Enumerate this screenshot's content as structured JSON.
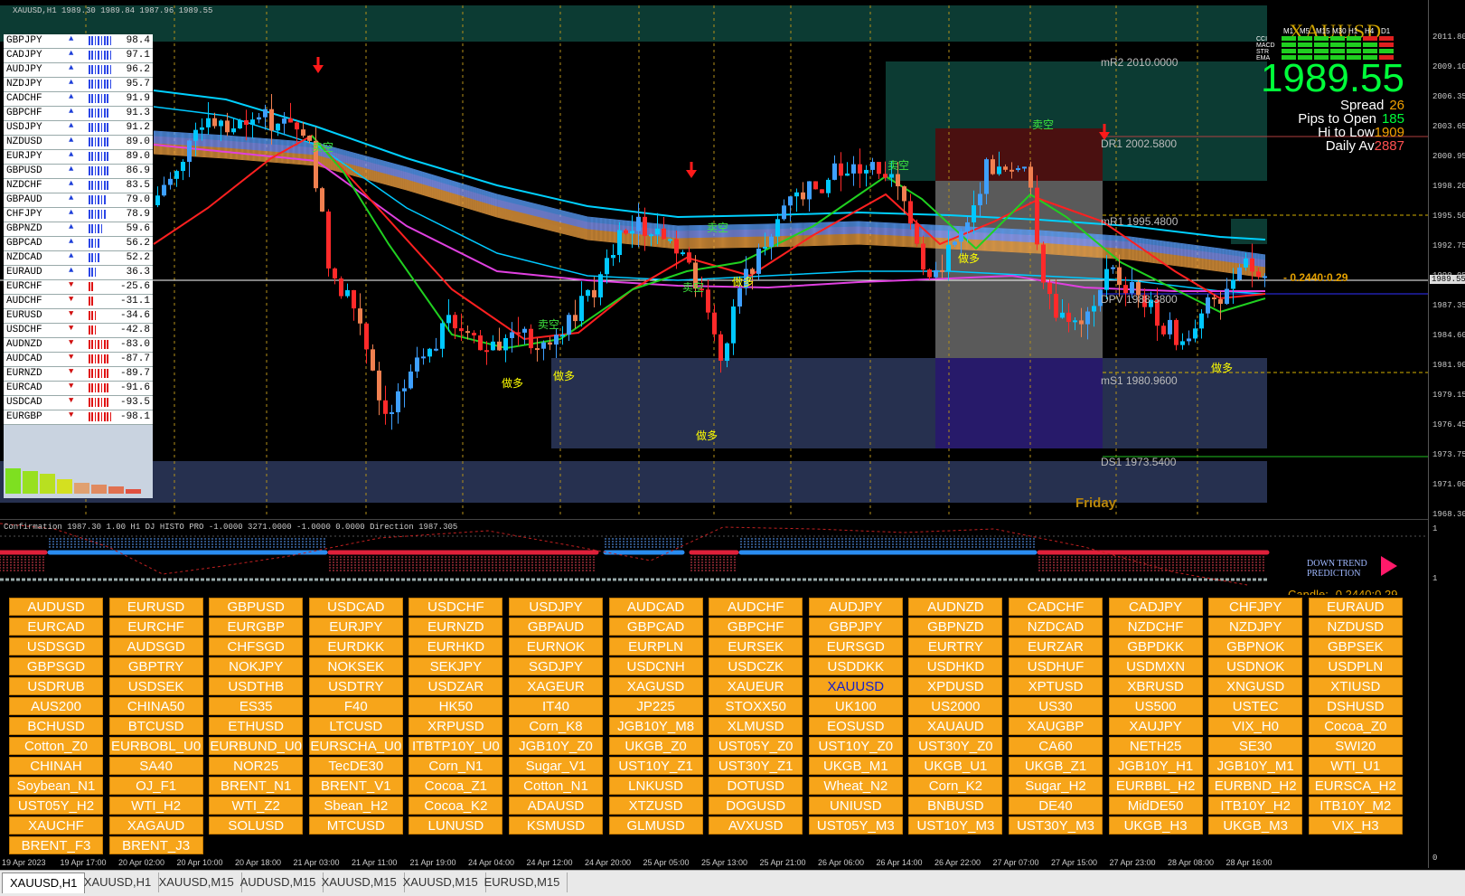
{
  "chart_header": "XAUUSD,H1  1989.30 1989.84 1987.96 1989.55",
  "symbol": "XAUUSD",
  "price_axis": [
    "2011.80",
    "2009.10",
    "2006.35",
    "2003.65",
    "2000.95",
    "1998.20",
    "1995.50",
    "1992.75",
    "1990.05",
    "1987.35",
    "1984.60",
    "1981.90",
    "1979.15",
    "1976.45",
    "1973.75",
    "1971.00",
    "1968.30"
  ],
  "current_price_tag": "1989.55",
  "osc_axis": [
    "1",
    "1",
    "0"
  ],
  "info_panel": {
    "title": "XAUUSD",
    "tf_labels": [
      "M1",
      "M5",
      "M15",
      "M30",
      "H1",
      "H4",
      "D1"
    ],
    "row_labels": [
      "CCI",
      "MACD",
      "STR",
      "EMA"
    ],
    "price": "1989.55",
    "spread_label": "Spread",
    "spread_value": "26",
    "pips_label": "Pips to Open",
    "pips_value": "185",
    "hilo_label": "Hi to Low",
    "hilo_value": "1909",
    "daily_label": "Daily Av",
    "daily_value": "2887"
  },
  "strength_table": [
    {
      "sym": "GBPJPY",
      "val": "98.4",
      "up": true
    },
    {
      "sym": "CADJPY",
      "val": "97.1",
      "up": true
    },
    {
      "sym": "AUDJPY",
      "val": "96.2",
      "up": true
    },
    {
      "sym": "NZDJPY",
      "val": "95.7",
      "up": true
    },
    {
      "sym": "CADCHF",
      "val": "91.9",
      "up": true
    },
    {
      "sym": "GBPCHF",
      "val": "91.3",
      "up": true
    },
    {
      "sym": "USDJPY",
      "val": "91.2",
      "up": true
    },
    {
      "sym": "NZDUSD",
      "val": "89.0",
      "up": true
    },
    {
      "sym": "EURJPY",
      "val": "89.0",
      "up": true
    },
    {
      "sym": "GBPUSD",
      "val": "86.9",
      "up": true
    },
    {
      "sym": "NZDCHF",
      "val": "83.5",
      "up": true
    },
    {
      "sym": "GBPAUD",
      "val": "79.0",
      "up": true
    },
    {
      "sym": "CHFJPY",
      "val": "78.9",
      "up": true
    },
    {
      "sym": "GBPNZD",
      "val": "59.6",
      "up": true
    },
    {
      "sym": "GBPCAD",
      "val": "56.2",
      "up": true
    },
    {
      "sym": "NZDCAD",
      "val": "52.2",
      "up": true
    },
    {
      "sym": "EURAUD",
      "val": "36.3",
      "up": true
    },
    {
      "sym": "EURCHF",
      "val": "-25.6",
      "up": false
    },
    {
      "sym": "AUDCHF",
      "val": "-31.1",
      "up": false
    },
    {
      "sym": "EURUSD",
      "val": "-34.6",
      "up": false
    },
    {
      "sym": "USDCHF",
      "val": "-42.8",
      "up": false
    },
    {
      "sym": "AUDNZD",
      "val": "-83.0",
      "up": false
    },
    {
      "sym": "AUDCAD",
      "val": "-87.7",
      "up": false
    },
    {
      "sym": "EURNZD",
      "val": "-89.7",
      "up": false
    },
    {
      "sym": "EURCAD",
      "val": "-91.6",
      "up": false
    },
    {
      "sym": "USDCAD",
      "val": "-93.5",
      "up": false
    },
    {
      "sym": "EURGBP",
      "val": "-98.1",
      "up": false
    }
  ],
  "currency_labels": [
    "GBP",
    "CAD",
    "NZD",
    "AUD",
    "EUR",
    "USD",
    "CHF",
    "JPY"
  ],
  "zones": {
    "mR2": "mR2  2010.0000",
    "DR1": "DR1  2002.5800",
    "mR1": "mR1  1995.4800",
    "DPV": "DPV  1988.3800",
    "mS1": "mS1  1980.9600",
    "DS1": "DS1  1973.5400"
  },
  "signals": {
    "buy": "做多",
    "sell": "卖空"
  },
  "friday_label": "Friday",
  "price_line_label": "0.2440:0.29",
  "osc_header": "Confirmation 1987.30 1.00  H1 DJ HISTO PRO -1.0000 3271.0000 -1.0000 0.0000  Direction 1987.305",
  "prediction": {
    "line1": "DOWN TREND",
    "line2": "PREDICTION"
  },
  "candle_label": "Candle: -0.2440:0.29",
  "buttons": [
    "AUDUSD",
    "EURUSD",
    "GBPUSD",
    "USDCAD",
    "USDCHF",
    "USDJPY",
    "AUDCAD",
    "AUDCHF",
    "AUDJPY",
    "AUDNZD",
    "CADCHF",
    "CADJPY",
    "CHFJPY",
    "EURAUD",
    "EURCAD",
    "EURCHF",
    "EURGBP",
    "EURJPY",
    "EURNZD",
    "GBPAUD",
    "GBPCAD",
    "GBPCHF",
    "GBPJPY",
    "GBPNZD",
    "NZDCAD",
    "NZDCHF",
    "NZDJPY",
    "NZDUSD",
    "USDSGD",
    "AUDSGD",
    "CHFSGD",
    "EURDKK",
    "EURHKD",
    "EURNOK",
    "EURPLN",
    "EURSEK",
    "EURSGD",
    "EURTRY",
    "EURZAR",
    "GBPDKK",
    "GBPNOK",
    "GBPSEK",
    "GBPSGD",
    "GBPTRY",
    "NOKJPY",
    "NOKSEK",
    "SEKJPY",
    "SGDJPY",
    "USDCNH",
    "USDCZK",
    "USDDKK",
    "USDHKD",
    "USDHUF",
    "USDMXN",
    "USDNOK",
    "USDPLN",
    "USDRUB",
    "USDSEK",
    "USDTHB",
    "USDTRY",
    "USDZAR",
    "XAGEUR",
    "XAGUSD",
    "XAUEUR",
    "XAUUSD",
    "XPDUSD",
    "XPTUSD",
    "XBRUSD",
    "XNGUSD",
    "XTIUSD",
    "AUS200",
    "CHINA50",
    "ES35",
    "F40",
    "HK50",
    "IT40",
    "JP225",
    "STOXX50",
    "UK100",
    "US2000",
    "US30",
    "US500",
    "USTEC",
    "DSHUSD",
    "BCHUSD",
    "BTCUSD",
    "ETHUSD",
    "LTCUSD",
    "XRPUSD",
    "Corn_K8",
    "JGB10Y_M8",
    "XLMUSD",
    "EOSUSD",
    "XAUAUD",
    "XAUGBP",
    "XAUJPY",
    "VIX_H0",
    "Cocoa_Z0",
    "Cotton_Z0",
    "EURBOBL_U0",
    "EURBUND_U0",
    "EURSCHA_U0",
    "ITBTP10Y_U0",
    "JGB10Y_Z0",
    "UKGB_Z0",
    "UST05Y_Z0",
    "UST10Y_Z0",
    "UST30Y_Z0",
    "CA60",
    "NETH25",
    "SE30",
    "SWI20",
    "CHINAH",
    "SA40",
    "NOR25",
    "TecDE30",
    "Corn_N1",
    "Sugar_V1",
    "UST10Y_Z1",
    "UST30Y_Z1",
    "UKGB_M1",
    "UKGB_U1",
    "UKGB_Z1",
    "JGB10Y_H1",
    "JGB10Y_M1",
    "WTI_U1",
    "Soybean_N1",
    "OJ_F1",
    "BRENT_N1",
    "BRENT_V1",
    "Cocoa_Z1",
    "Cotton_N1",
    "LNKUSD",
    "DOTUSD",
    "Wheat_N2",
    "Corn_K2",
    "Sugar_H2",
    "EURBBL_H2",
    "EURBND_H2",
    "EURSCA_H2",
    "UST05Y_H2",
    "WTI_H2",
    "WTI_Z2",
    "Sbean_H2",
    "Cocoa_K2",
    "ADAUSD",
    "XTZUSD",
    "DOGUSD",
    "UNIUSD",
    "BNBUSD",
    "DE40",
    "MidDE50",
    "ITB10Y_H2",
    "ITB10Y_M2",
    "XAUCHF",
    "XAGAUD",
    "SOLUSD",
    "MTCUSD",
    "LUNUSD",
    "KSMUSD",
    "GLMUSD",
    "AVXUSD",
    "UST05Y_M3",
    "UST10Y_M3",
    "UST30Y_M3",
    "UKGB_H3",
    "UKGB_M3",
    "VIX_H3",
    "BRENT_F3",
    "BRENT_J3"
  ],
  "selected_button": "XAUUSD",
  "time_axis": [
    "19 Apr 2023",
    "19 Apr 17:00",
    "20 Apr 02:00",
    "20 Apr 10:00",
    "20 Apr 18:00",
    "21 Apr 03:00",
    "21 Apr 11:00",
    "21 Apr 19:00",
    "24 Apr 04:00",
    "24 Apr 12:00",
    "24 Apr 20:00",
    "25 Apr 05:00",
    "25 Apr 13:00",
    "25 Apr 21:00",
    "26 Apr 06:00",
    "26 Apr 14:00",
    "26 Apr 22:00",
    "27 Apr 07:00",
    "27 Apr 15:00",
    "27 Apr 23:00",
    "28 Apr 08:00",
    "28 Apr 16:00"
  ],
  "tabs": [
    "XAUUSD,H1",
    "XAUUSD,H1",
    "XAUUSD,M15",
    "AUDUSD,M15",
    "XAUUSD,M15",
    "XAUUSD,M15",
    "EURUSD,M15"
  ],
  "colors": {
    "buttons": "#f7a51a",
    "price_up": "#00ff3a",
    "ema_fast": "#ff2020",
    "ema_slow": "#00d0ff",
    "magenta": "#e040e0",
    "green_line": "#20d020"
  }
}
